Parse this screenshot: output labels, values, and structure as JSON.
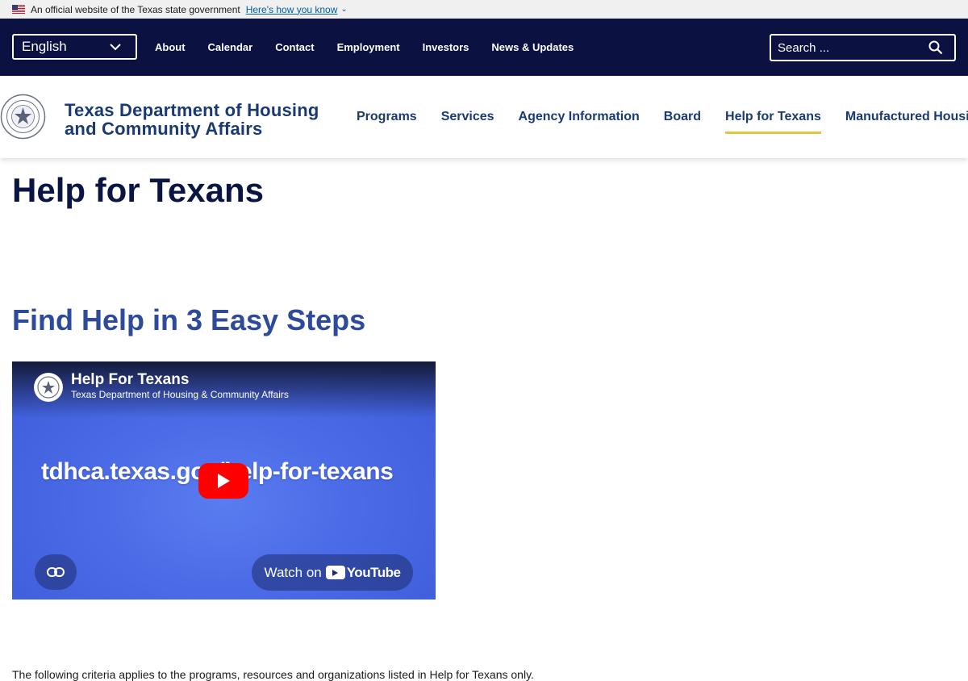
{
  "gov_banner": {
    "text": "An official website of the Texas state government",
    "link": "Here's how you know"
  },
  "util_nav": {
    "language": "English",
    "links": [
      "About",
      "Calendar",
      "Contact",
      "Employment",
      "Investors",
      "News & Updates"
    ],
    "search_placeholder": "Search ..."
  },
  "header": {
    "agency_line1": "Texas Department of Housing",
    "agency_line2": "and Community Affairs",
    "nav": [
      "Programs",
      "Services",
      "Agency Information",
      "Board",
      "Help for Texans",
      "Manufactured Housing"
    ],
    "active_nav": "Help for Texans"
  },
  "main": {
    "page_title": "Help for Texans",
    "section_title": "Find Help in 3 Easy Steps",
    "video": {
      "title": "Help For Texans",
      "channel": "Texas Department of Housing & Community Affairs",
      "url_text": "tdhca.texas.gov/help-for-texans",
      "watch_label": "Watch on",
      "youtube_label": "YouTube"
    },
    "criteria_text": "The following criteria applies to the programs, resources and organizations listed in Help for Texans only."
  },
  "colors": {
    "navy": "#0b1140",
    "heading_blue": "#1a3a73",
    "accent_gold": "#e3c33f",
    "section_blue": "#2e4a9a",
    "youtube_red": "#ff0000"
  },
  "icons": [
    "us-flag-icon",
    "chevron-down-icon",
    "search-icon",
    "agency-seal-icon",
    "play-icon",
    "link-icon",
    "youtube-icon"
  ]
}
